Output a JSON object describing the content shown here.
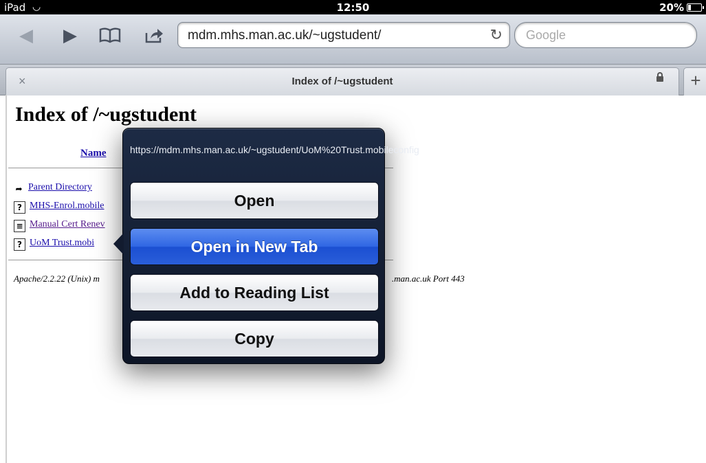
{
  "status_bar": {
    "carrier": "iPad",
    "time": "12:50",
    "battery": "20%",
    "battery_level": 0.2,
    "wifi_icon": "wifi-icon"
  },
  "toolbar": {
    "url": "mdm.mhs.man.ac.uk/~ugstudent/",
    "search_placeholder": "Google",
    "icons": [
      "back-icon",
      "forward-icon",
      "bookmarks-icon",
      "share-icon",
      "reload-icon"
    ]
  },
  "tab": {
    "title": "Index of /~ugstudent",
    "close": "×",
    "new_tab": "+"
  },
  "page": {
    "heading": "Index of /~ugstudent",
    "column_name": "Name",
    "files": [
      {
        "label": "Parent Directory",
        "icon": "folder-back-icon"
      },
      {
        "label": "MHS-Enrol.mobile",
        "icon": "unknown-file-icon"
      },
      {
        "label": "Manual Cert Renev",
        "icon": "text-file-icon"
      },
      {
        "label": "UoM Trust.mobi",
        "icon": "unknown-file-icon"
      }
    ],
    "footer_left": "Apache/2.2.22 (Unix) m",
    "footer_right": ".man.ac.uk Port 443"
  },
  "popover": {
    "url": "https://mdm.mhs.man.ac.uk/~ugstudent/UoM%20Trust.mobileconfig",
    "buttons": {
      "open": "Open",
      "open_new_tab": "Open in New Tab",
      "reading_list": "Add to Reading List",
      "copy": "Copy"
    },
    "highlight_color": "#2f66e3"
  }
}
